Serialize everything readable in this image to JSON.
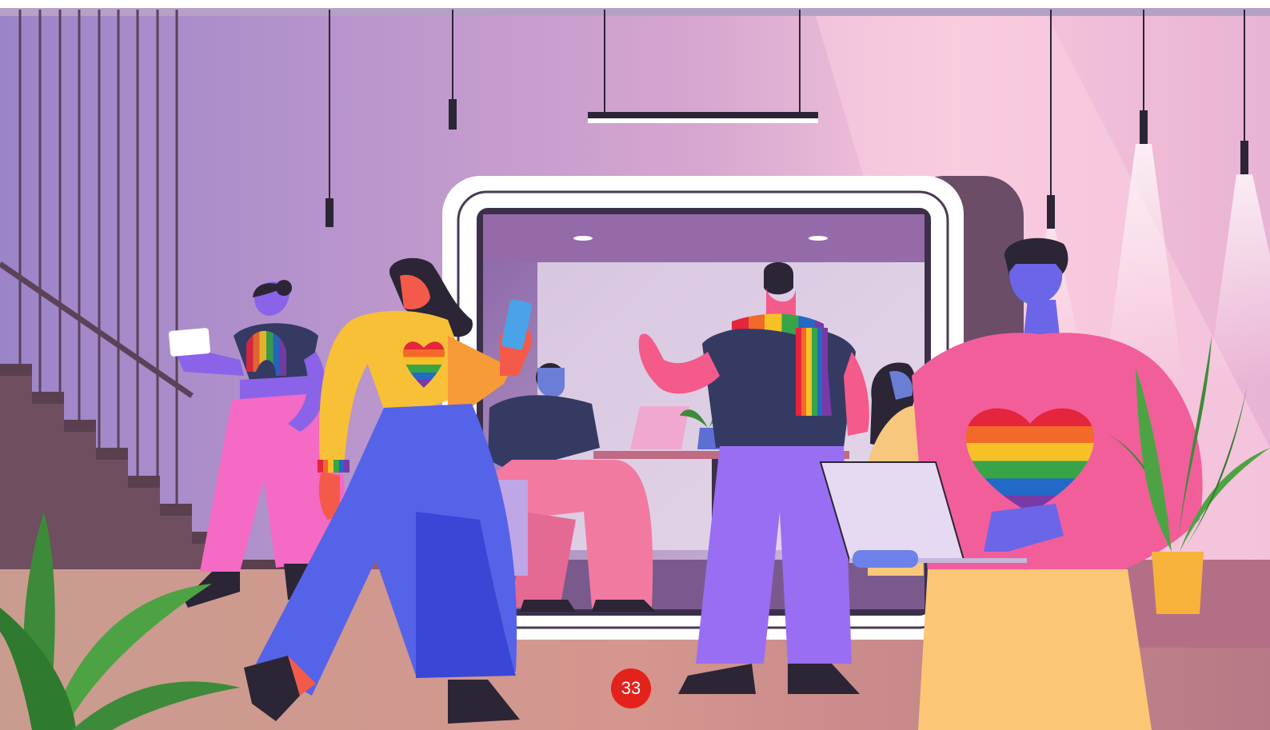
{
  "scene": {
    "description_icon": "office-pride-illustration",
    "colors": {
      "wall_left": "#a98bd0",
      "wall_right": "#f6c6da",
      "floor": "#c7868f",
      "pod_frame": "#ffffff",
      "pod_inner": "#7a5b94",
      "badge": "#e3221c"
    }
  },
  "page_marker": {
    "number": "33"
  }
}
